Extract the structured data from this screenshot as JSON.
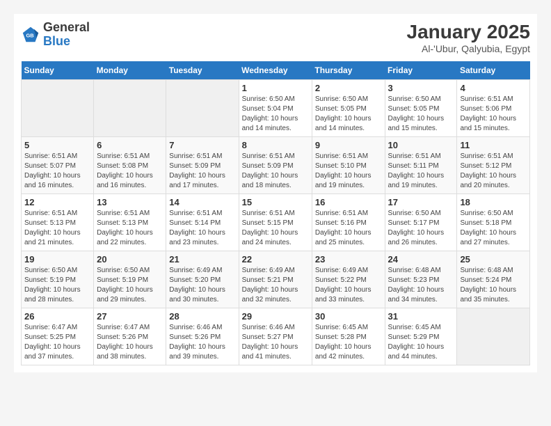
{
  "header": {
    "logo_line1": "General",
    "logo_line2": "Blue",
    "month": "January 2025",
    "location": "Al-'Ubur, Qalyubia, Egypt"
  },
  "weekdays": [
    "Sunday",
    "Monday",
    "Tuesday",
    "Wednesday",
    "Thursday",
    "Friday",
    "Saturday"
  ],
  "weeks": [
    [
      {
        "day": "",
        "info": ""
      },
      {
        "day": "",
        "info": ""
      },
      {
        "day": "",
        "info": ""
      },
      {
        "day": "1",
        "info": "Sunrise: 6:50 AM\nSunset: 5:04 PM\nDaylight: 10 hours\nand 14 minutes."
      },
      {
        "day": "2",
        "info": "Sunrise: 6:50 AM\nSunset: 5:05 PM\nDaylight: 10 hours\nand 14 minutes."
      },
      {
        "day": "3",
        "info": "Sunrise: 6:50 AM\nSunset: 5:05 PM\nDaylight: 10 hours\nand 15 minutes."
      },
      {
        "day": "4",
        "info": "Sunrise: 6:51 AM\nSunset: 5:06 PM\nDaylight: 10 hours\nand 15 minutes."
      }
    ],
    [
      {
        "day": "5",
        "info": "Sunrise: 6:51 AM\nSunset: 5:07 PM\nDaylight: 10 hours\nand 16 minutes."
      },
      {
        "day": "6",
        "info": "Sunrise: 6:51 AM\nSunset: 5:08 PM\nDaylight: 10 hours\nand 16 minutes."
      },
      {
        "day": "7",
        "info": "Sunrise: 6:51 AM\nSunset: 5:09 PM\nDaylight: 10 hours\nand 17 minutes."
      },
      {
        "day": "8",
        "info": "Sunrise: 6:51 AM\nSunset: 5:09 PM\nDaylight: 10 hours\nand 18 minutes."
      },
      {
        "day": "9",
        "info": "Sunrise: 6:51 AM\nSunset: 5:10 PM\nDaylight: 10 hours\nand 19 minutes."
      },
      {
        "day": "10",
        "info": "Sunrise: 6:51 AM\nSunset: 5:11 PM\nDaylight: 10 hours\nand 19 minutes."
      },
      {
        "day": "11",
        "info": "Sunrise: 6:51 AM\nSunset: 5:12 PM\nDaylight: 10 hours\nand 20 minutes."
      }
    ],
    [
      {
        "day": "12",
        "info": "Sunrise: 6:51 AM\nSunset: 5:13 PM\nDaylight: 10 hours\nand 21 minutes."
      },
      {
        "day": "13",
        "info": "Sunrise: 6:51 AM\nSunset: 5:13 PM\nDaylight: 10 hours\nand 22 minutes."
      },
      {
        "day": "14",
        "info": "Sunrise: 6:51 AM\nSunset: 5:14 PM\nDaylight: 10 hours\nand 23 minutes."
      },
      {
        "day": "15",
        "info": "Sunrise: 6:51 AM\nSunset: 5:15 PM\nDaylight: 10 hours\nand 24 minutes."
      },
      {
        "day": "16",
        "info": "Sunrise: 6:51 AM\nSunset: 5:16 PM\nDaylight: 10 hours\nand 25 minutes."
      },
      {
        "day": "17",
        "info": "Sunrise: 6:50 AM\nSunset: 5:17 PM\nDaylight: 10 hours\nand 26 minutes."
      },
      {
        "day": "18",
        "info": "Sunrise: 6:50 AM\nSunset: 5:18 PM\nDaylight: 10 hours\nand 27 minutes."
      }
    ],
    [
      {
        "day": "19",
        "info": "Sunrise: 6:50 AM\nSunset: 5:19 PM\nDaylight: 10 hours\nand 28 minutes."
      },
      {
        "day": "20",
        "info": "Sunrise: 6:50 AM\nSunset: 5:19 PM\nDaylight: 10 hours\nand 29 minutes."
      },
      {
        "day": "21",
        "info": "Sunrise: 6:49 AM\nSunset: 5:20 PM\nDaylight: 10 hours\nand 30 minutes."
      },
      {
        "day": "22",
        "info": "Sunrise: 6:49 AM\nSunset: 5:21 PM\nDaylight: 10 hours\nand 32 minutes."
      },
      {
        "day": "23",
        "info": "Sunrise: 6:49 AM\nSunset: 5:22 PM\nDaylight: 10 hours\nand 33 minutes."
      },
      {
        "day": "24",
        "info": "Sunrise: 6:48 AM\nSunset: 5:23 PM\nDaylight: 10 hours\nand 34 minutes."
      },
      {
        "day": "25",
        "info": "Sunrise: 6:48 AM\nSunset: 5:24 PM\nDaylight: 10 hours\nand 35 minutes."
      }
    ],
    [
      {
        "day": "26",
        "info": "Sunrise: 6:47 AM\nSunset: 5:25 PM\nDaylight: 10 hours\nand 37 minutes."
      },
      {
        "day": "27",
        "info": "Sunrise: 6:47 AM\nSunset: 5:26 PM\nDaylight: 10 hours\nand 38 minutes."
      },
      {
        "day": "28",
        "info": "Sunrise: 6:46 AM\nSunset: 5:26 PM\nDaylight: 10 hours\nand 39 minutes."
      },
      {
        "day": "29",
        "info": "Sunrise: 6:46 AM\nSunset: 5:27 PM\nDaylight: 10 hours\nand 41 minutes."
      },
      {
        "day": "30",
        "info": "Sunrise: 6:45 AM\nSunset: 5:28 PM\nDaylight: 10 hours\nand 42 minutes."
      },
      {
        "day": "31",
        "info": "Sunrise: 6:45 AM\nSunset: 5:29 PM\nDaylight: 10 hours\nand 44 minutes."
      },
      {
        "day": "",
        "info": ""
      }
    ]
  ]
}
